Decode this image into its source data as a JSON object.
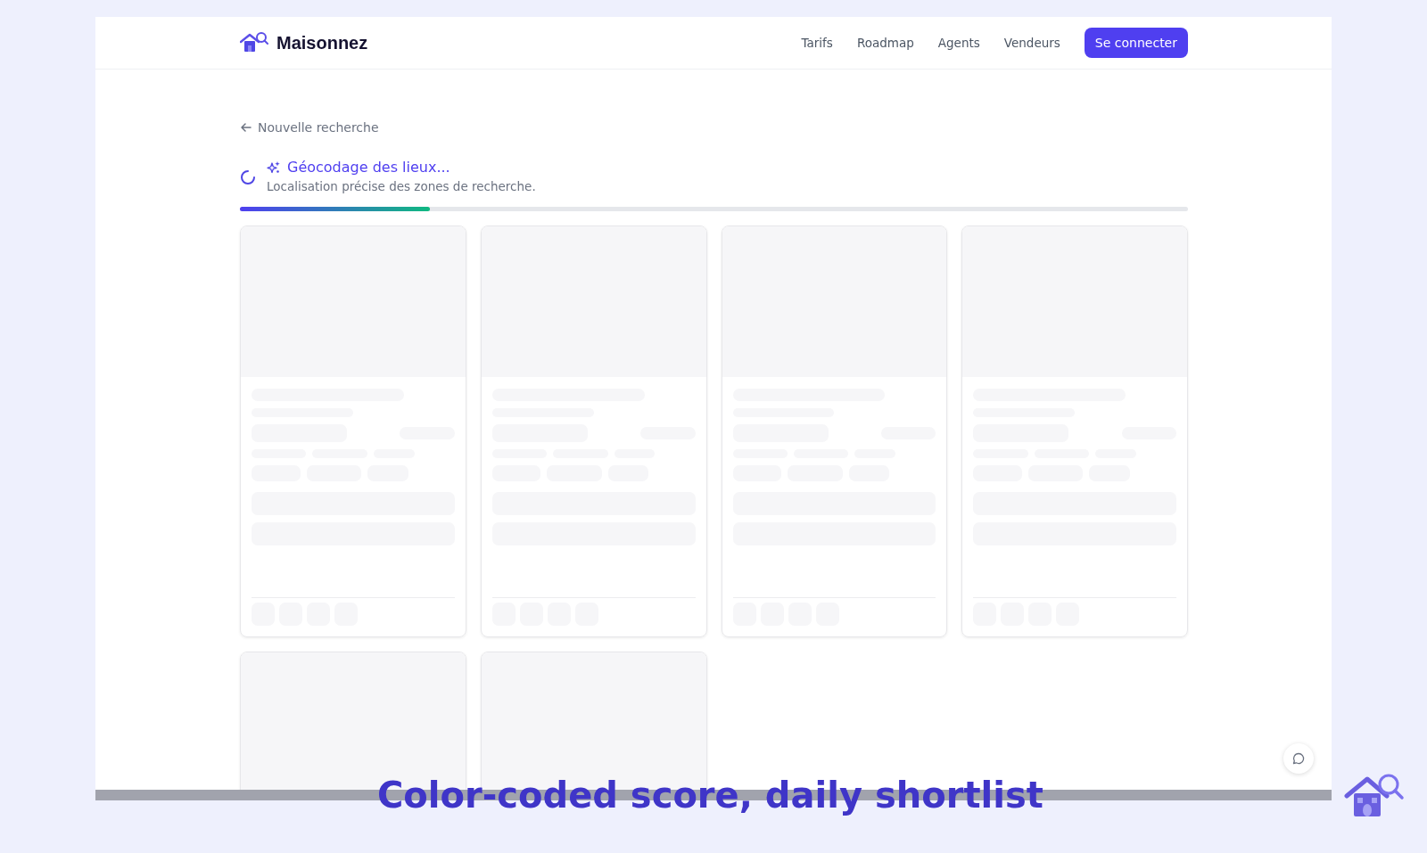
{
  "nav": {
    "brand": "Maisonnez",
    "links": [
      {
        "label": "Tarifs"
      },
      {
        "label": "Roadmap"
      },
      {
        "label": "Agents"
      },
      {
        "label": "Vendeurs"
      }
    ],
    "cta": "Se connecter"
  },
  "back_link": "Nouvelle recherche",
  "status": {
    "title": "Géocodage des lieux...",
    "subtitle": "Localisation précise des zones de recherche.",
    "level": 0.2
  },
  "cards": [
    {
      "kind": "skeleton"
    },
    {
      "kind": "skeleton"
    },
    {
      "kind": "skeleton"
    },
    {
      "kind": "skeleton"
    },
    {
      "kind": "skeleton"
    },
    {
      "kind": "skeleton"
    }
  ],
  "caption": "Color-coded score, daily shortlist"
}
